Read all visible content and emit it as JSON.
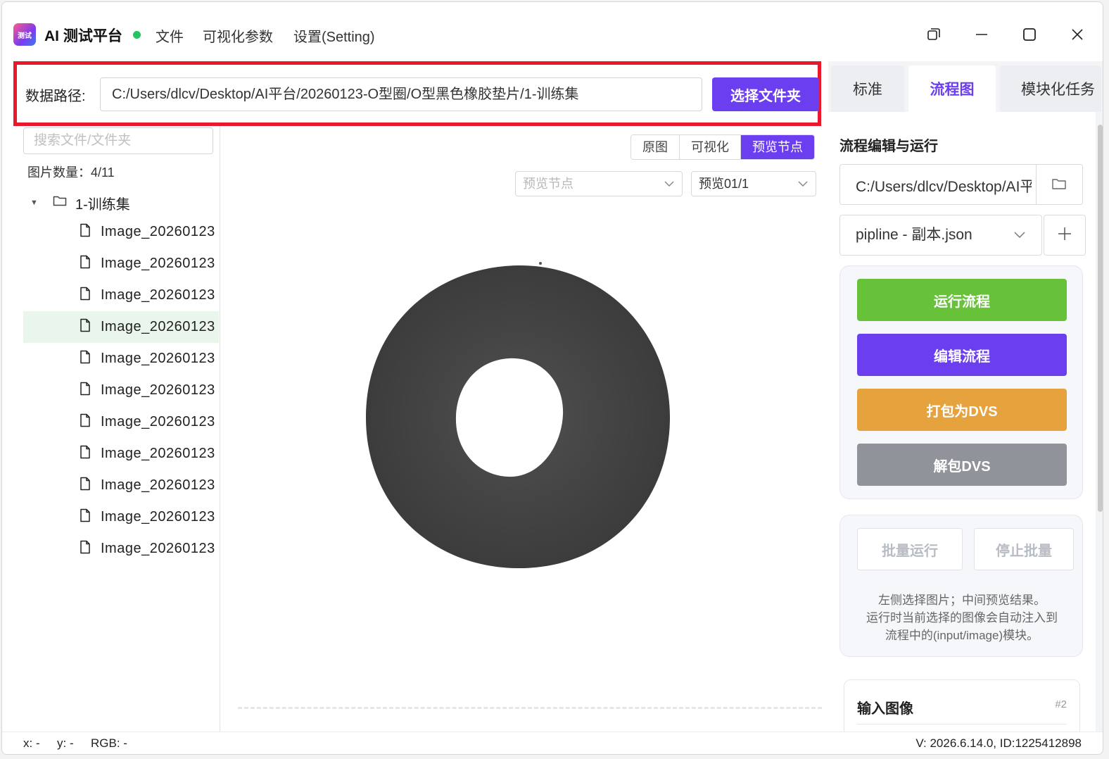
{
  "app": {
    "logo_text": "测试",
    "title": "AI 测试平台",
    "status_color": "#22c55e",
    "menu": [
      "文件",
      "可视化参数",
      "设置(Setting)"
    ]
  },
  "pathbar": {
    "label": "数据路径:",
    "value": "C:/Users/dlcv/Desktop/AI平台/20260123-O型圈/O型黑色橡胶垫片/1-训练集",
    "button": "选择文件夹"
  },
  "left": {
    "search_placeholder": "搜索文件/文件夹",
    "image_count": "图片数量：4/11",
    "folder": "1-训练集",
    "files": [
      "Image_20260123",
      "Image_20260123",
      "Image_20260123",
      "Image_20260123",
      "Image_20260123",
      "Image_20260123",
      "Image_20260123",
      "Image_20260123",
      "Image_20260123",
      "Image_20260123",
      "Image_20260123"
    ],
    "selected_index": 3
  },
  "center": {
    "view_modes": [
      "原图",
      "可视化",
      "预览节点"
    ],
    "active_mode": 2,
    "node_select_placeholder": "预览节点",
    "preview_select": "预览01/1"
  },
  "right": {
    "tabs": [
      "标准",
      "流程图",
      "模块化任务"
    ],
    "active_tab": 1,
    "section_title": "流程编辑与运行",
    "pipeline_path": "C:/Users/dlcv/Desktop/AI平台",
    "pipeline_file": "pipline - 副本.json",
    "actions": [
      {
        "label": "运行流程",
        "color": "#67c23a"
      },
      {
        "label": "编辑流程",
        "color": "#6b3ef0"
      },
      {
        "label": "打包为DVS",
        "color": "#e6a23c"
      },
      {
        "label": "解包DVS",
        "color": "#909399"
      }
    ],
    "batch_run": "批量运行",
    "batch_stop": "停止批量",
    "hint_lines": [
      "左侧选择图片；中间预览结果。",
      "运行时当前选择的图像会自动注入到",
      "流程中的(input/image)模块。"
    ],
    "node": {
      "title": "输入图像",
      "id": "#2"
    }
  },
  "statusbar": {
    "x": "x: -",
    "y": "y: -",
    "rgb": "RGB: -",
    "version": "V: 2026.6.14.0, ID:1225412898"
  },
  "colors": {
    "accent": "#6b3ef0",
    "highlight_border": "#e8192c",
    "selected_row": "#eaf5ec"
  }
}
